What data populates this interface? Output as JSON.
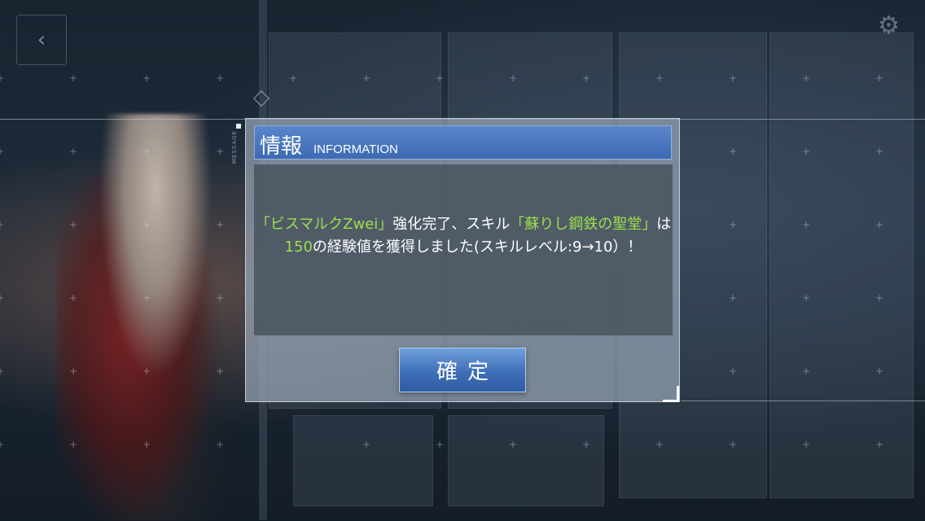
{
  "background": {
    "top_title": "",
    "icons": [
      "back-arrow-icon",
      "gear-icon",
      "diamond-marker-icon"
    ]
  },
  "side_label": "MESSAGE",
  "dialog": {
    "title": "情報",
    "subtitle": "INFORMATION",
    "message": {
      "seg1": "「ビスマルクZwei」",
      "seg2": "強化完了、スキル",
      "seg3": "「蘇りし鋼鉄の聖堂」",
      "seg4": "は",
      "seg5": "150",
      "seg6": "の経験値を獲得しました(スキルレベル:9→10）！"
    },
    "confirm_label": "確定",
    "highlight_color": "#9be04a",
    "header_color": "#3d6ab3"
  }
}
